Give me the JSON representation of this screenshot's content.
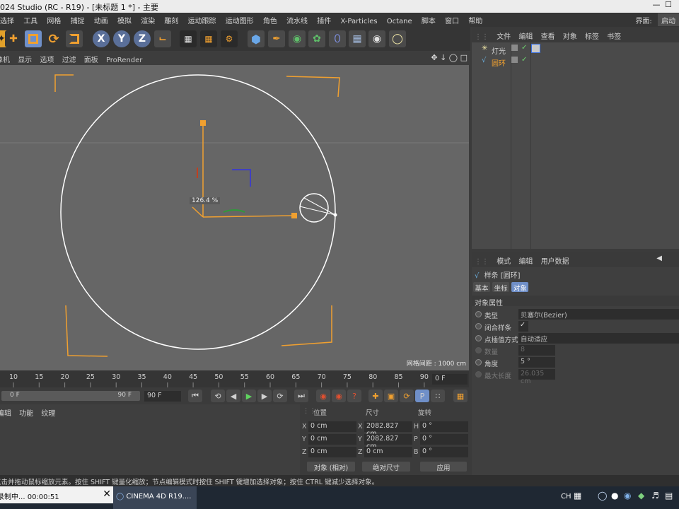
{
  "window": {
    "title": "024 Studio (RC - R19) - [未标题 1 *] - 主要"
  },
  "menu": {
    "items": [
      "选择",
      "工具",
      "网格",
      "捕捉",
      "动画",
      "模拟",
      "渲染",
      "雕刻",
      "运动跟踪",
      "运动图形",
      "角色",
      "流水线",
      "插件",
      "X-Particles",
      "Octane",
      "脚本",
      "窗口",
      "帮助"
    ],
    "layout_label": "界面:",
    "layout_value": "启动"
  },
  "toolbar": {
    "icons": [
      "move-icon",
      "scale-icon",
      "rotate-icon",
      "last-tool-icon",
      "x-axis-icon",
      "y-axis-icon",
      "z-axis-icon",
      "coord-system-icon",
      "render-view-icon",
      "render-picture-viewer-icon",
      "render-settings-icon",
      "cube-icon",
      "pen-icon",
      "subdivide-icon",
      "cloner-icon",
      "deformer-icon",
      "floor-icon",
      "camera-icon",
      "light-icon"
    ],
    "axis_labels": [
      "X",
      "Y",
      "Z"
    ]
  },
  "viewport_menu": {
    "items": [
      "摄像机",
      "显示",
      "选项",
      "过滤",
      "面板",
      "ProRender"
    ]
  },
  "viewport": {
    "scale_label": "126.4 %",
    "grid_spacing": "网格间距 : 1000 cm",
    "colors": {
      "background": "#666666",
      "circle": "#ffffff",
      "frame": "#f0a030",
      "axis_x": "#f0a030",
      "axis_y": "#f0a030",
      "axis_z": "#4040c0"
    }
  },
  "object_manager": {
    "menu": [
      "文件",
      "编辑",
      "查看",
      "对象",
      "标签",
      "书签"
    ],
    "objects": [
      {
        "name": "灯光",
        "icon": "light-icon",
        "color": "#cfcfcf"
      },
      {
        "name": "圆环",
        "icon": "spline-icon",
        "color": "#f0a030"
      }
    ]
  },
  "attributes": {
    "menu": [
      "模式",
      "编辑",
      "用户数据"
    ],
    "object_title": "样条 [圆环]",
    "tabs": [
      "基本",
      "坐标",
      "对象"
    ],
    "active_tab": "对象",
    "section": "对象属性",
    "rows": [
      {
        "label": "类型",
        "value": "贝塞尔(Bezier)",
        "enabled": true
      },
      {
        "label": "闭合样条",
        "value": "✓",
        "enabled": true
      },
      {
        "label": "点插值方式",
        "value": "自动适应",
        "enabled": true
      },
      {
        "label": "数量",
        "value": "8",
        "enabled": false
      },
      {
        "label": "角度",
        "value": "5 °",
        "enabled": true
      },
      {
        "label": "最大长度",
        "value": "26.035 cm",
        "enabled": false
      }
    ]
  },
  "timeline": {
    "ticks": [
      "10",
      "15",
      "20",
      "25",
      "30",
      "35",
      "40",
      "45",
      "50",
      "55",
      "60",
      "65",
      "70",
      "75",
      "80",
      "85",
      "90"
    ],
    "current_frame": "0 F",
    "range_start": "0 F",
    "range_end": "90 F",
    "end_field": "90 F"
  },
  "material_panel": {
    "menu": [
      "编辑",
      "功能",
      "纹理"
    ]
  },
  "coordinates": {
    "headers": [
      "位置",
      "尺寸",
      "旋转"
    ],
    "position": [
      {
        "axis": "X",
        "value": "0 cm"
      },
      {
        "axis": "Y",
        "value": "0 cm"
      },
      {
        "axis": "Z",
        "value": "0 cm"
      }
    ],
    "size": [
      {
        "axis": "X",
        "value": "2082.827 cm"
      },
      {
        "axis": "Y",
        "value": "2082.827 cm"
      },
      {
        "axis": "Z",
        "value": "0 cm"
      }
    ],
    "rotation": [
      {
        "axis": "H",
        "value": "0 °"
      },
      {
        "axis": "P",
        "value": "0 °"
      },
      {
        "axis": "B",
        "value": "0 °"
      }
    ],
    "mode_select": "对象 (相对)",
    "size_select": "绝对尺寸",
    "apply_label": "应用"
  },
  "status_bar": {
    "text": "点击并拖动鼠标缩放元素。按住 SHIFT 键量化缩放；节点编辑模式时按住 SHIFT 键增加选择对象；按住 CTRL 键减少选择对象。"
  },
  "taskbar": {
    "recording": "录制中... 00:00:51",
    "app_label": "CINEMA 4D R19....",
    "tray_lang": "CH"
  }
}
